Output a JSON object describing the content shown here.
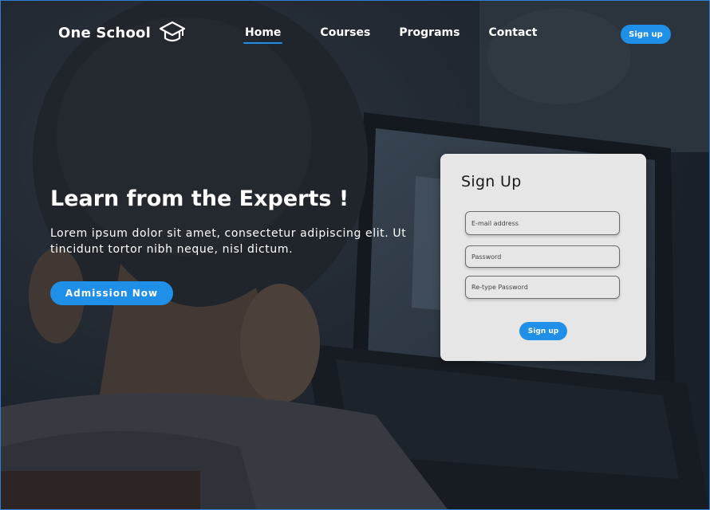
{
  "nav": {
    "brand_name": "One School",
    "brand_icon": "graduation-cap-icon",
    "links": [
      {
        "label": "Home",
        "active": true
      },
      {
        "label": "Courses",
        "active": false
      },
      {
        "label": "Programs",
        "active": false
      },
      {
        "label": "Contact",
        "active": false
      }
    ],
    "signup_label": "Sign up"
  },
  "hero": {
    "title": "Learn from the Experts !",
    "text": "Lorem ipsum dolor sit amet, consectetur adipiscing elit. Ut tincidunt tortor nibh neque, nisl dictum.",
    "cta_label": "Admission Now"
  },
  "signup_form": {
    "title": "Sign Up",
    "email_placeholder": "E-mail address",
    "password_placeholder": "Password",
    "retype_placeholder": "Re-type Password",
    "submit_label": "Sign up"
  },
  "colors": {
    "accent": "#1f8fe8",
    "card_background": "#e6e6e6",
    "text_light": "#ffffff"
  }
}
